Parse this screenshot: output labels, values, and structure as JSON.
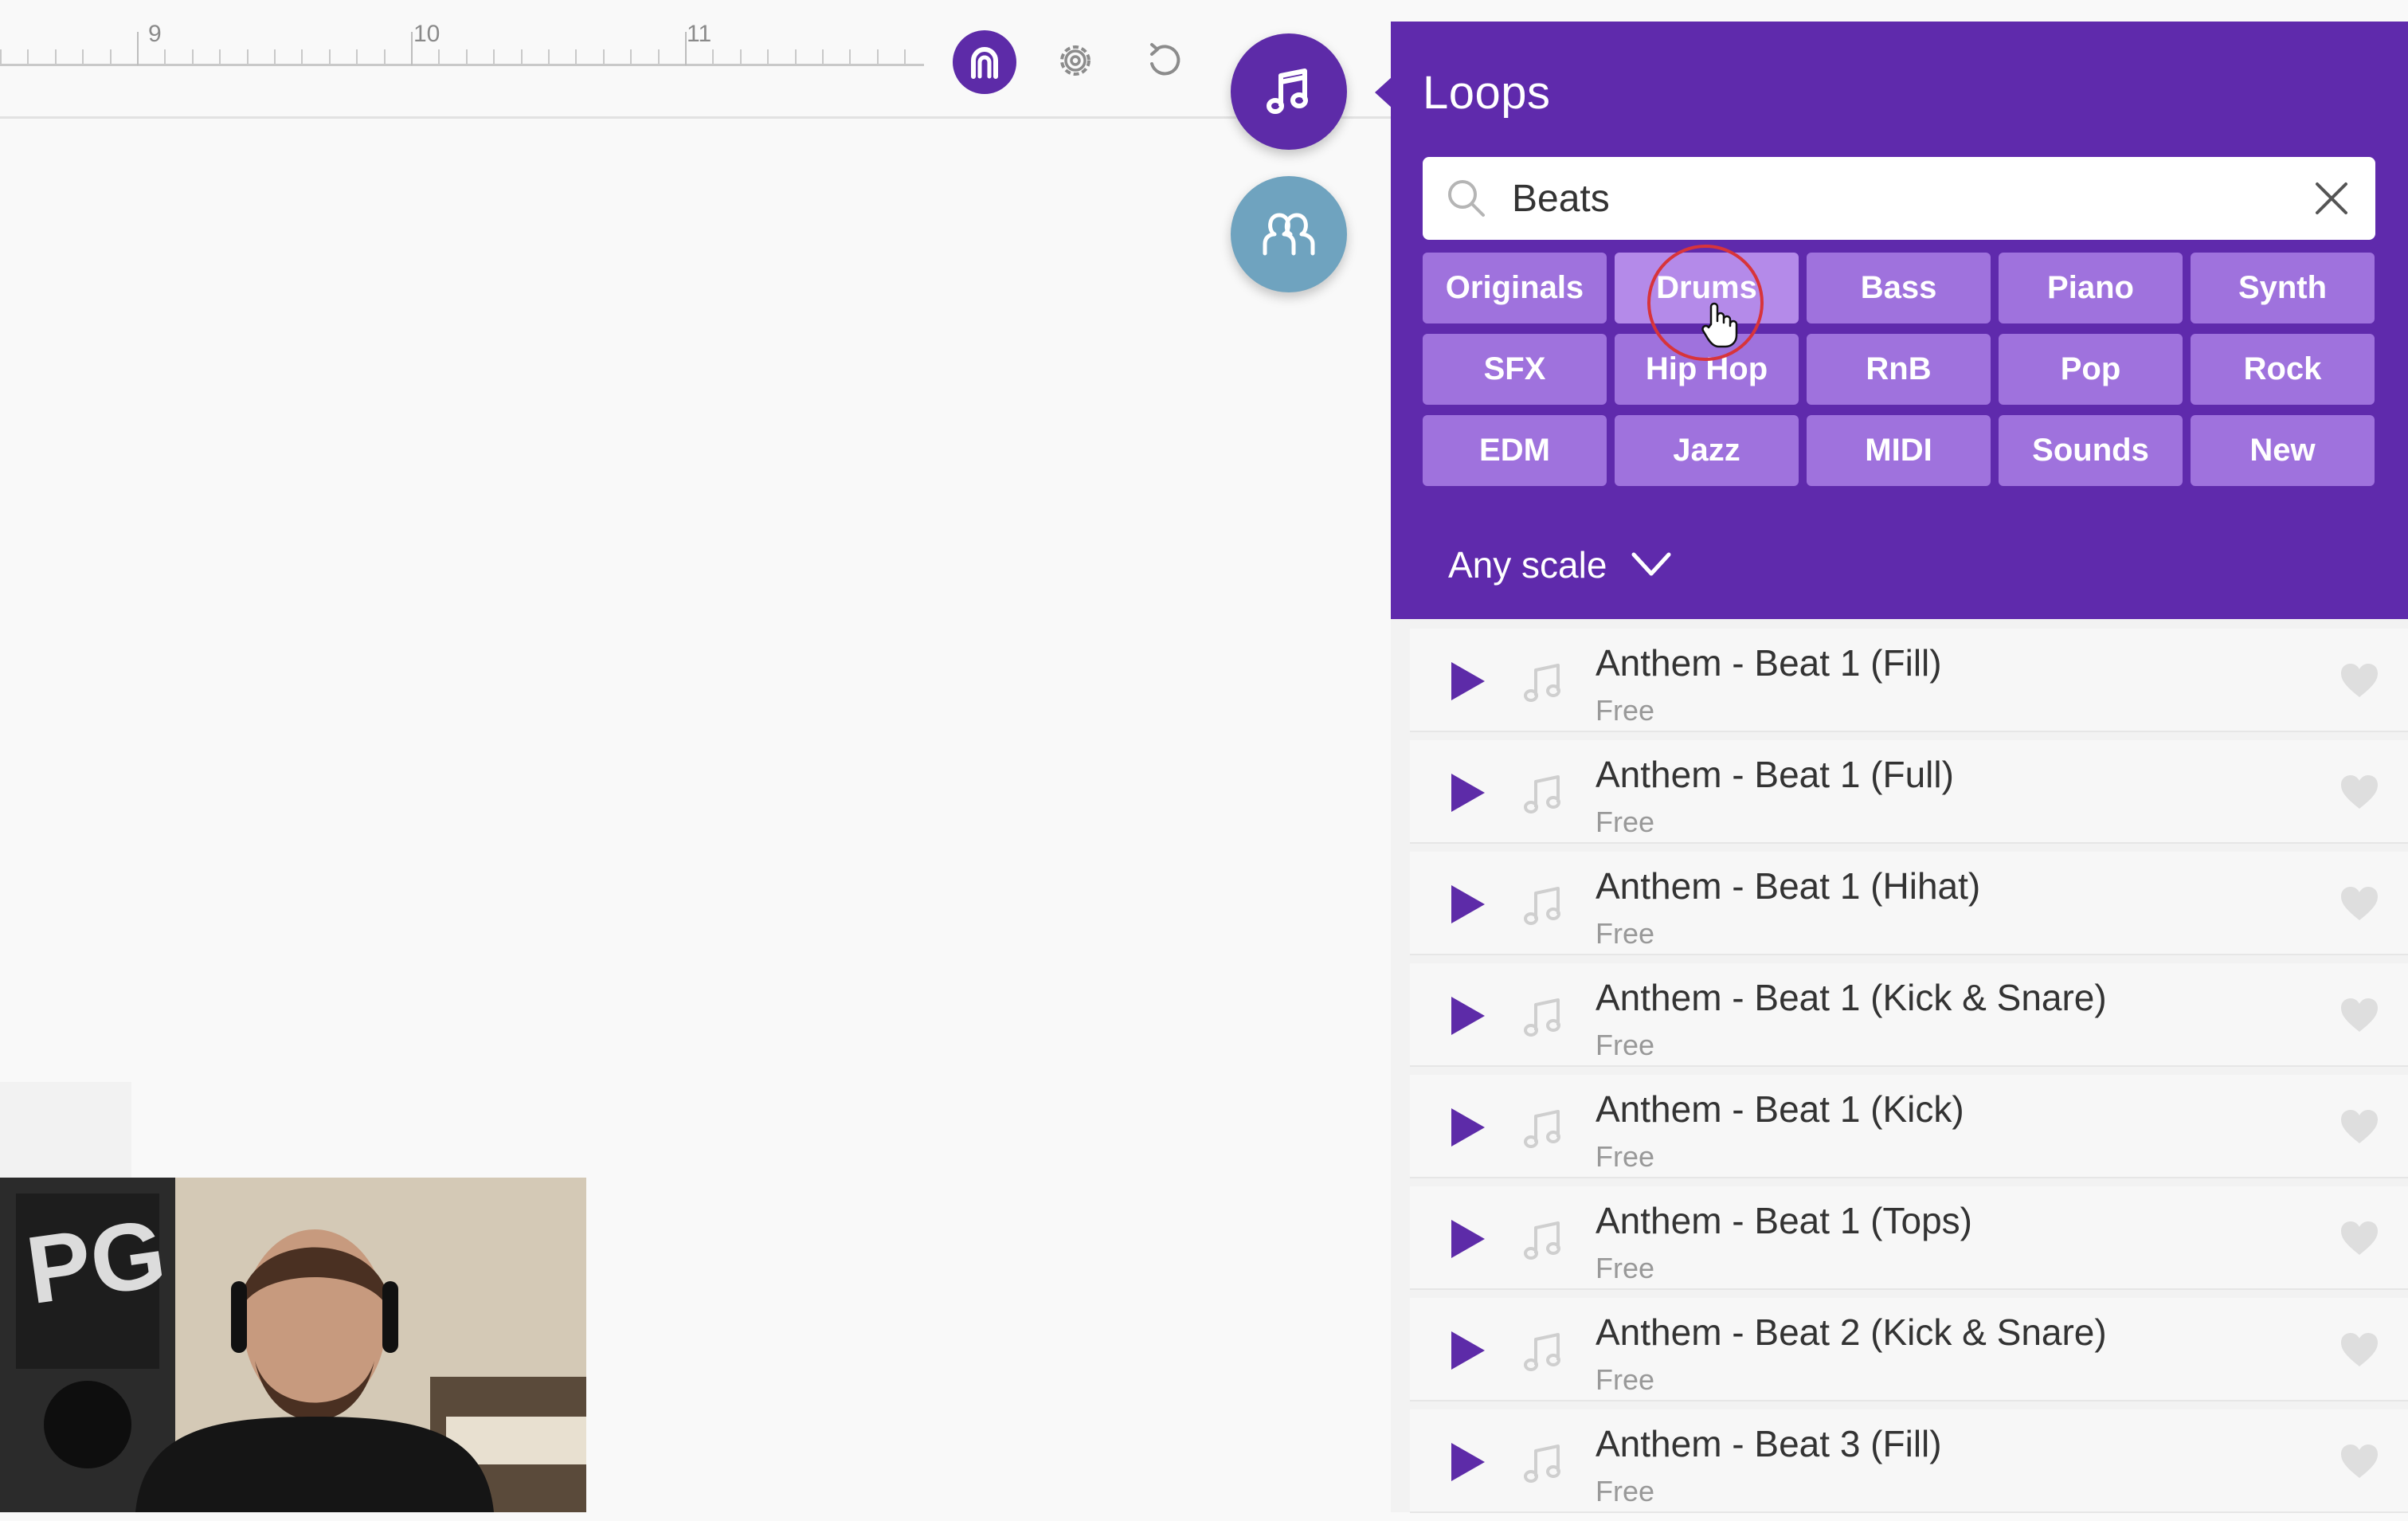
{
  "ruler": {
    "labels": [
      "9",
      "10",
      "11"
    ]
  },
  "toolbar": {
    "loop_mode_icon": "loop-mode-icon",
    "settings_icon": "gear-icon",
    "redo_icon": "redo-icon",
    "loops_icon": "music-note-icon",
    "collab_icon": "users-icon"
  },
  "panel": {
    "title": "Loops",
    "search": {
      "value": "Beats",
      "clear_icon": "close-icon",
      "search_icon": "search-icon"
    },
    "genres": [
      "Originals",
      "Drums",
      "Bass",
      "Piano",
      "Synth",
      "SFX",
      "Hip Hop",
      "RnB",
      "Pop",
      "Rock",
      "EDM",
      "Jazz",
      "MIDI",
      "Sounds",
      "New"
    ],
    "active_genre": "Drums",
    "scale": {
      "label": "Any scale",
      "icon": "chevron-down-icon"
    },
    "loops": [
      {
        "title": "Anthem - Beat 1 (Fill)",
        "price": "Free"
      },
      {
        "title": "Anthem - Beat 1 (Full)",
        "price": "Free"
      },
      {
        "title": "Anthem - Beat 1 (Hihat)",
        "price": "Free"
      },
      {
        "title": "Anthem - Beat 1 (Kick & Snare)",
        "price": "Free"
      },
      {
        "title": "Anthem - Beat 1 (Kick)",
        "price": "Free"
      },
      {
        "title": "Anthem - Beat 1 (Tops)",
        "price": "Free"
      },
      {
        "title": "Anthem - Beat 2 (Kick & Snare)",
        "price": "Free"
      },
      {
        "title": "Anthem - Beat 3 (Fill)",
        "price": "Free"
      }
    ]
  },
  "colors": {
    "brand_purple": "#5f2aac",
    "genre_button": "#9f72dd",
    "play_icon": "#5d2ba8",
    "collab_button": "#6fa3bf"
  }
}
